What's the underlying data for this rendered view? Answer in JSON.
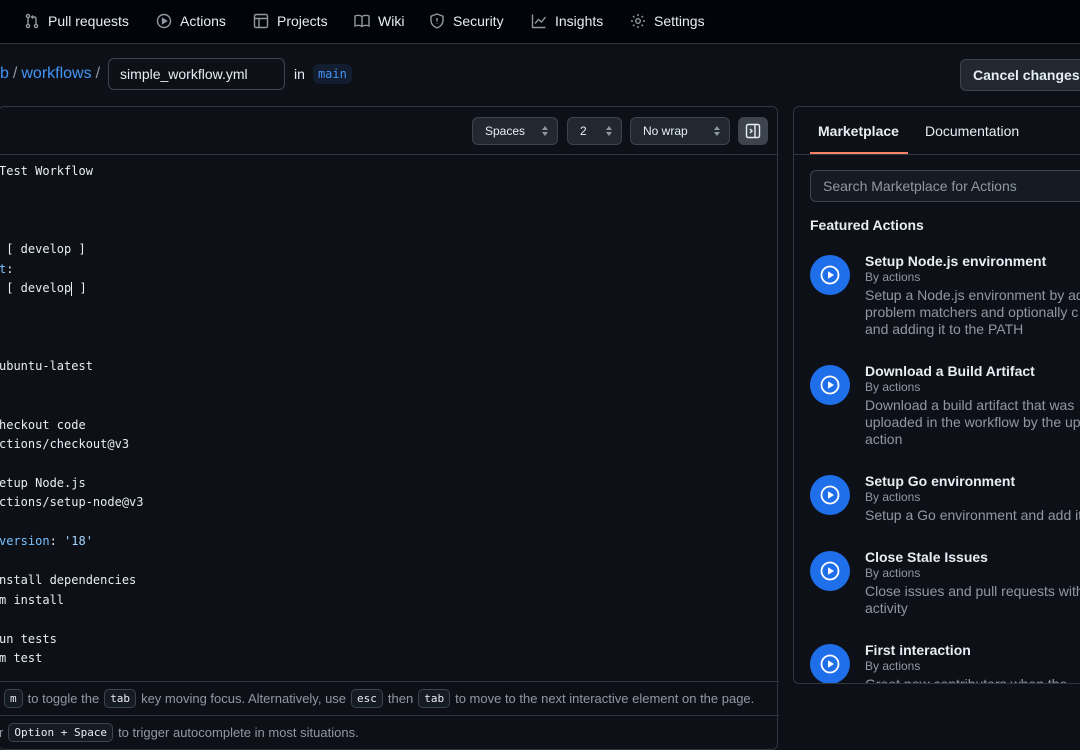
{
  "nav": {
    "items": [
      {
        "label": "Pull requests",
        "icon": "pull-request-icon"
      },
      {
        "label": "Actions",
        "icon": "play-icon"
      },
      {
        "label": "Projects",
        "icon": "table-icon"
      },
      {
        "label": "Wiki",
        "icon": "book-icon"
      },
      {
        "label": "Security",
        "icon": "shield-icon"
      },
      {
        "label": "Insights",
        "icon": "graph-icon"
      },
      {
        "label": "Settings",
        "icon": "gear-icon"
      }
    ]
  },
  "breadcrumb": {
    "repo_fragment": "b",
    "folder": "workflows",
    "sep": "/",
    "filename": "simple_workflow.yml",
    "in_label": "in",
    "branch": "main"
  },
  "header": {
    "cancel_label": "Cancel changes"
  },
  "editor": {
    "indent_mode": "Spaces",
    "indent_size": "2",
    "wrap_mode": "No wrap",
    "lines": {
      "l1": "Test Workflow",
      "l2a": " [ develop ]",
      "l3a": "t",
      "l3b": ":",
      "l4a": " [ develop",
      "l4b": " ]",
      "l5": "ubuntu-latest",
      "l6": "heckout code",
      "l7": "ctions/checkout@v3",
      "l8": "etup Node.js",
      "l9": "ctions/setup-node@v3",
      "l10a": "version",
      "l10b": ": ",
      "l10c": "'18'",
      "l11": "nstall dependencies",
      "l12": "m install",
      "l13": "un tests",
      "l14": "m test"
    },
    "hint1": {
      "k1": "m",
      "t1": "to toggle the",
      "k2": "tab",
      "t2": "key moving focus. Alternatively, use",
      "k3": "esc",
      "t3": "then",
      "k4": "tab",
      "t4": "to move to the next interactive element on the page."
    },
    "hint2": {
      "t0": "r",
      "k1": "Option + Space",
      "t1": "to trigger autocomplete in most situations."
    }
  },
  "marketplace": {
    "tabs": [
      "Marketplace",
      "Documentation"
    ],
    "search_placeholder": "Search Marketplace for Actions",
    "featured_title": "Featured Actions",
    "actions": [
      {
        "name": "Setup Node.js environment",
        "by": "By actions",
        "desc": [
          "Setup a Node.js environment by ad",
          "problem matchers and optionally c",
          "and adding it to the PATH"
        ]
      },
      {
        "name": "Download a Build Artifact",
        "by": "By actions",
        "desc": [
          "Download a build artifact that was",
          "uploaded in the workflow by the up",
          "action"
        ]
      },
      {
        "name": "Setup Go environment",
        "by": "By actions",
        "desc": [
          "Setup a Go environment and add it"
        ]
      },
      {
        "name": "Close Stale Issues",
        "by": "By actions",
        "desc": [
          "Close issues and pull requests with",
          "activity"
        ]
      },
      {
        "name": "First interaction",
        "by": "By actions",
        "desc": [
          "Greet new contributors when the"
        ]
      }
    ]
  },
  "colors": {
    "accent": "#4493f8",
    "action_icon": "#1f6feb",
    "tab_underline": "#f78166"
  }
}
